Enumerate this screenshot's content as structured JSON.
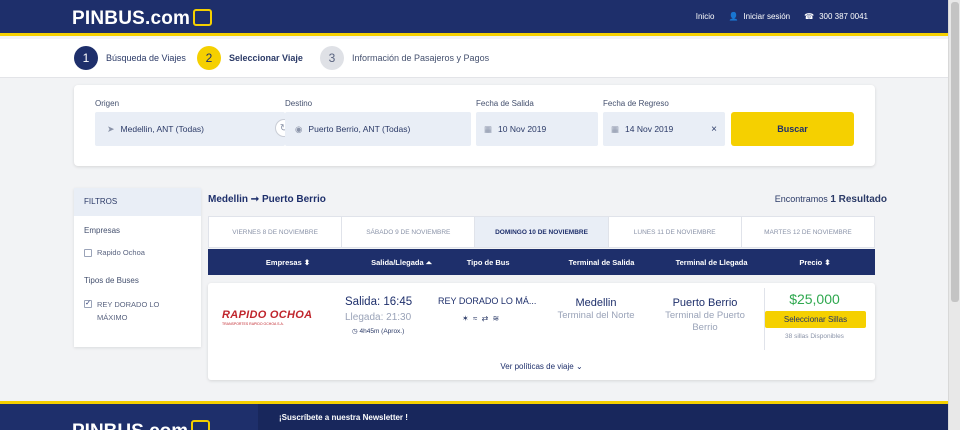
{
  "header": {
    "logo_text": "PINBUS.com",
    "nav": {
      "home": "Inicio",
      "login": "Iniciar sesión",
      "phone": "300 387 0041"
    }
  },
  "steps": [
    {
      "num": "1",
      "label": "Búsqueda de Viajes"
    },
    {
      "num": "2",
      "label": "Seleccionar Viaje"
    },
    {
      "num": "3",
      "label": "Información de Pasajeros y Pagos"
    }
  ],
  "search": {
    "origin_label": "Origen",
    "origin_value": "Medellin, ANT (Todas)",
    "dest_label": "Destino",
    "dest_value": "Puerto Berrio, ANT (Todas)",
    "depart_label": "Fecha de Salida",
    "depart_value": "10 Nov 2019",
    "return_label": "Fecha de Regreso",
    "return_value": "14 Nov 2019",
    "clear_symbol": "×",
    "button": "Buscar"
  },
  "filters": {
    "title": "FILTROS",
    "companies_label": "Empresas",
    "companies": [
      "Rapido Ochoa"
    ],
    "bus_types_label": "Tipos de Buses",
    "bus_types": [
      "REY DORADO LO MÁXIMO"
    ]
  },
  "results": {
    "route": "Medellin ➞ Puerto Berrio",
    "found_prefix": "Encontramos",
    "found_count": "1 Resultado",
    "dates": [
      "VIERNES 8 DE NOVIEMBRE",
      "SÁBADO 9 DE NOVIEMBRE",
      "DOMINGO 10 DE NOVIEMBRE",
      "LUNES 11 DE NOVIEMBRE",
      "MARTES 12 DE NOVIEMBRE"
    ],
    "columns": [
      "Empresas ⬍",
      "Salida/Llegada ⏶",
      "Tipo de Bus",
      "Terminal de Salida",
      "Terminal de Llegada",
      "Precio ⬍"
    ],
    "trip": {
      "company_logo_text": "RAPIDO OCHOA",
      "company_logo_sub": "TRANSPORTES RAPIDO OCHOA S.A.",
      "departure": "Salida: 16:45",
      "arrival": "Llegada: 21:30",
      "duration": "4h45m (Aprox.)",
      "bus_type": "REY DORADO LO MÁ...",
      "origin_city": "Medellin",
      "origin_terminal": "Terminal del Norte",
      "dest_city": "Puerto Berrio",
      "dest_terminal": "Terminal de Puerto Berrio",
      "price": "$25,000",
      "select_button": "Seleccionar Sillas",
      "seats": "38 sillas Disponibles",
      "policies": "Ver políticas de viaje"
    }
  },
  "footer": {
    "logo_text": "PINBUS.com",
    "newsletter": "¡Suscríbete a nuestra Newsletter !"
  },
  "colors": {
    "primary": "#1e2f6b",
    "accent": "#f5d000",
    "price": "#2fa84f"
  }
}
